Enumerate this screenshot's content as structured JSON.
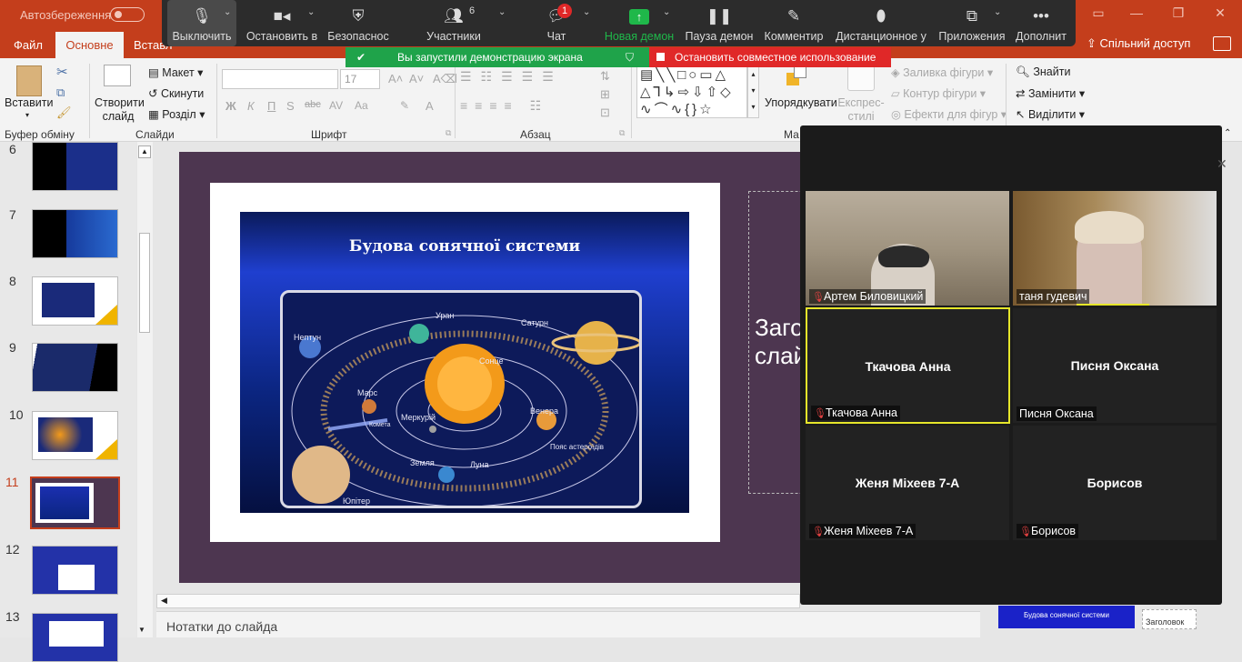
{
  "titlebar": {
    "autosave": "Автозбереження"
  },
  "tabs": {
    "file": "Файл",
    "home": "Основне",
    "insert": "Вставл",
    "share": "Спільний доступ"
  },
  "zoom": {
    "items": [
      {
        "label": "Выключить",
        "icon": "mic-icon"
      },
      {
        "label": "Остановить в",
        "icon": "video-icon"
      },
      {
        "label": "Безопаснос",
        "icon": "shield-icon"
      },
      {
        "label": "Участники",
        "icon": "participants-icon",
        "count": "6"
      },
      {
        "label": "Чат",
        "icon": "chat-icon",
        "count": "1"
      },
      {
        "label": "Новая демон",
        "icon": "share-screen-icon"
      },
      {
        "label": "Пауза демон",
        "icon": "pause-icon"
      },
      {
        "label": "Комментир",
        "icon": "pen-icon"
      },
      {
        "label": "Дистанционное у",
        "icon": "mouse-icon"
      },
      {
        "label": "Приложения",
        "icon": "apps-icon"
      },
      {
        "label": "Дополнит",
        "icon": "more-icon"
      }
    ],
    "banner_green": "Вы запустили демонстрацию экрана",
    "banner_red": "Остановить совместное использование"
  },
  "ribbon": {
    "paste": "Вставити",
    "new_slide": "Створити слайд",
    "layout": "Макет",
    "reset": "Скинути",
    "section": "Розділ",
    "font_size": "17",
    "arrange": "Упорядкувати",
    "styles": "Експрес-стилі",
    "fill": "Заливка фігури",
    "outline": "Контур фігури",
    "effects": "Ефекти для фігур",
    "find": "Знайти",
    "replace": "Замінити",
    "select": "Виділити",
    "groups": {
      "clipboard": "Буфер обміну",
      "slides": "Слайди",
      "font": "Шрифт",
      "paragraph": "Абзац",
      "drawing": "Ма"
    }
  },
  "thumbs": [
    {
      "num": "6",
      "selected": false
    },
    {
      "num": "7",
      "selected": false
    },
    {
      "num": "8",
      "selected": false
    },
    {
      "num": "9",
      "selected": false
    },
    {
      "num": "10",
      "selected": false
    },
    {
      "num": "11",
      "selected": true
    },
    {
      "num": "12",
      "selected": false
    },
    {
      "num": "13",
      "selected": false
    }
  ],
  "slide": {
    "image_title": "Будова сонячної системи",
    "planets": [
      "Уран",
      "Нептун",
      "Сатурн",
      "Сонце",
      "Марс",
      "Меркурій",
      "Венера",
      "Комета",
      "Пояс астероїдів",
      "Земля",
      "Луна",
      "Юпітер"
    ],
    "placeholder_text": "Заго слай"
  },
  "notes": "Нотатки до слайда",
  "video": {
    "tiles": [
      {
        "name": "Артем Биловицкий",
        "center": "",
        "muted": true,
        "camera": true
      },
      {
        "name": "таня гудевич",
        "center": "",
        "muted": false,
        "camera": true
      },
      {
        "name": "Ткачова Анна",
        "center": "Ткачова Анна",
        "muted": true,
        "camera": false,
        "active": true
      },
      {
        "name": "Писня Оксана",
        "center": "Писня Оксана",
        "muted": false,
        "camera": false
      },
      {
        "name": "Женя Міхеев 7-А",
        "center": "Женя Міхеев 7-А",
        "muted": true,
        "camera": false
      },
      {
        "name": "Борисов",
        "center": "Борисов",
        "muted": true,
        "camera": false
      }
    ]
  },
  "preview": {
    "title": "Будова сонячної системи",
    "placeholder": "Заголовок"
  },
  "colors": {
    "accent": "#c43e1c",
    "zoom_green": "#1fa34a",
    "zoom_red": "#e02828",
    "slide_bg": "#4d3650"
  }
}
